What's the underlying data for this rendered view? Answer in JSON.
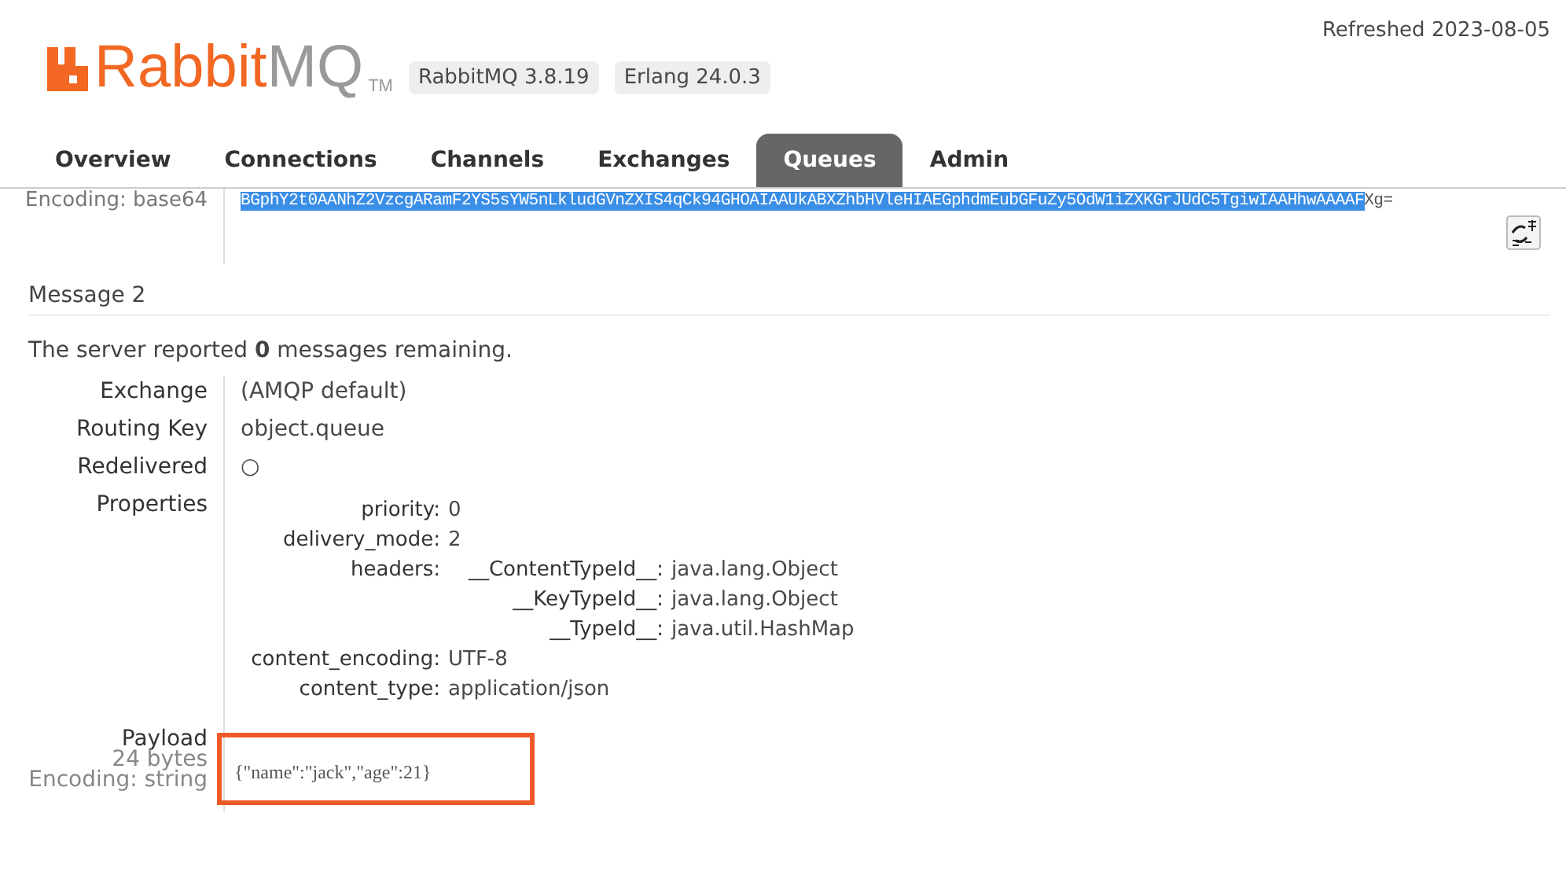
{
  "header": {
    "logo": {
      "brand": "Rabbit",
      "product": "MQ",
      "mark": "TM"
    },
    "badges": [
      "RabbitMQ 3.8.19",
      "Erlang 24.0.3"
    ],
    "refreshed": "Refreshed 2023-08-05"
  },
  "tabs": [
    {
      "label": "Overview",
      "selected": false
    },
    {
      "label": "Connections",
      "selected": false
    },
    {
      "label": "Channels",
      "selected": false
    },
    {
      "label": "Exchanges",
      "selected": false
    },
    {
      "label": "Queues",
      "selected": true
    },
    {
      "label": "Admin",
      "selected": false
    }
  ],
  "previous_message": {
    "encoding": "Encoding: base64",
    "payload_selected": "BGphY2t0AANhZ2VzcgARamF2YS5sYW5nLkludGVnZXIS4qCk94GHOAIAAUkABXZhbHVleHIAEGphdmEubGFuZy5OdW1iZXKGrJUdC5TgiwIAAHhwAAAAF",
    "payload_rest": "Xg="
  },
  "message": {
    "title": "Message 2",
    "remaining": "The server reported **0** messages remaining.",
    "fields": [
      {
        "label": "Exchange",
        "value": "(AMQP default)"
      },
      {
        "label": "Routing Key",
        "value": "object.queue"
      },
      {
        "label": "Redelivered",
        "value": "○"
      }
    ],
    "properties": {
      "label": "Properties",
      "items": [
        {
          "key": "priority:",
          "value": "0"
        },
        {
          "key": "delivery_mode:",
          "value": "2"
        },
        {
          "key": "headers:",
          "children": [
            {
              "key": "__ContentTypeId__:",
              "value": "java.lang.Object"
            },
            {
              "key": "__KeyTypeId__:",
              "value": "java.lang.Object"
            },
            {
              "key": "__TypeId__:",
              "value": "java.util.HashMap"
            }
          ]
        },
        {
          "key": "content_encoding:",
          "value": "UTF-8"
        },
        {
          "key": "content_type:",
          "value": "application/json"
        }
      ]
    },
    "payload": {
      "label": "Payload",
      "size": "24 bytes",
      "encoding": "Encoding: string",
      "value": "{\"name\":\"jack\",\"age\":21}",
      "highlighted": true
    }
  }
}
